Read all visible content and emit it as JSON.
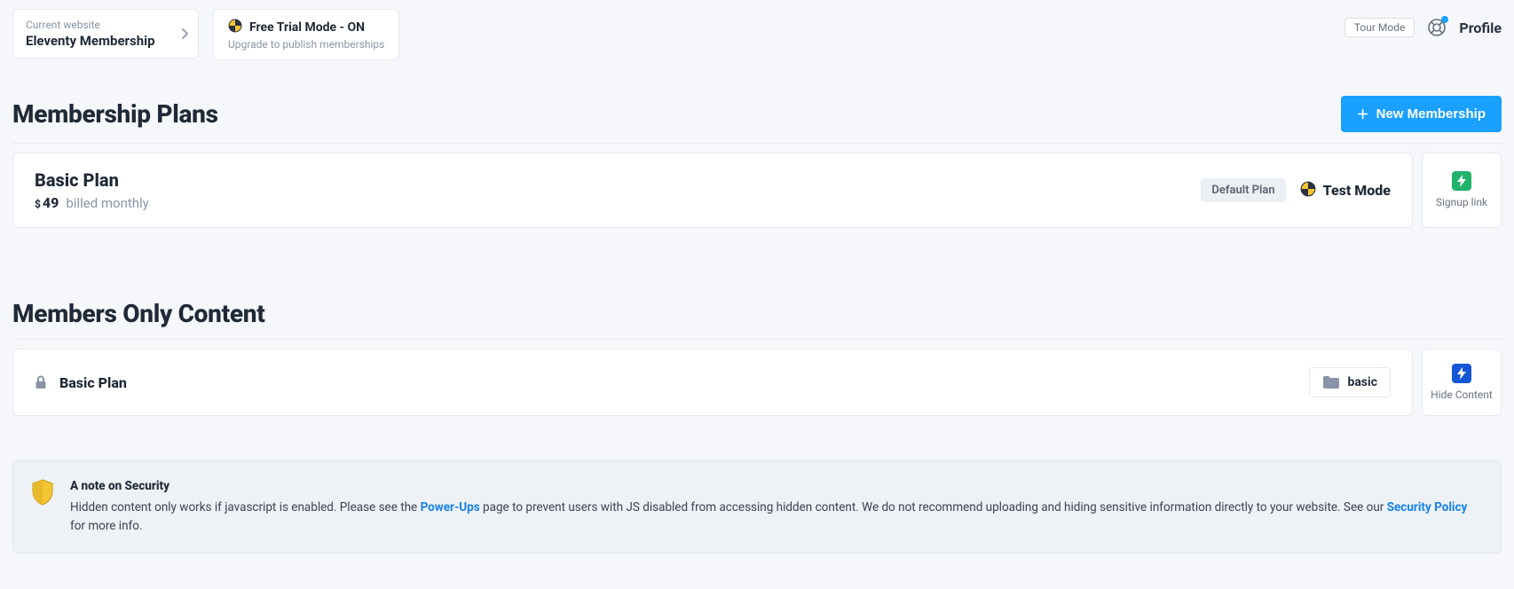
{
  "header": {
    "switcher_label": "Current website",
    "switcher_value": "Eleventy Membership",
    "trial_title": "Free Trial Mode - ON",
    "trial_sub": "Upgrade to publish memberships",
    "tour_mode": "Tour Mode",
    "profile": "Profile"
  },
  "plans": {
    "title": "Membership Plans",
    "new_button": "New Membership",
    "items": [
      {
        "name": "Basic Plan",
        "price": "49",
        "billing": "billed monthly",
        "default_badge": "Default Plan",
        "test_mode": "Test Mode",
        "side_label": "Signup link"
      }
    ]
  },
  "content": {
    "title": "Members Only Content",
    "items": [
      {
        "name": "Basic Plan",
        "folder": "basic",
        "side_label": "Hide Content"
      }
    ]
  },
  "note": {
    "title": "A note on Security",
    "t1": "Hidden content only works if javascript is enabled. Please see the ",
    "link1": "Power-Ups",
    "t2": " page to prevent users with JS disabled from accessing hidden content.  We do not recommend uploading and hiding sensitive information directly to your website. See our ",
    "link2": "Security Policy",
    "t3": " for more info."
  }
}
